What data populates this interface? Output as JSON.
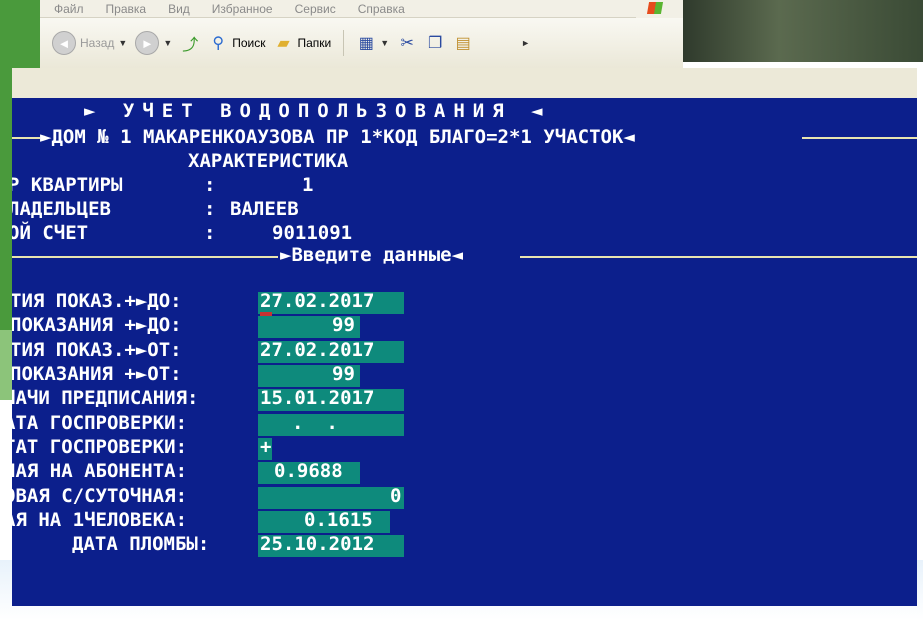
{
  "menu": [
    "Файл",
    "Правка",
    "Вид",
    "Избранное",
    "Сервис",
    "Справка"
  ],
  "toolbar": {
    "back_label": "Назад",
    "search_label": "Поиск",
    "folders_label": "Папки"
  },
  "dos": {
    "title": "► УЧЕТ ВОДОПОЛЬЗОВАНИЯ ◄",
    "header": "►ДОМ № 1 МАКАРЕНКОАУЗОВА ПР 1*КОД БЛАГО=2*1 УЧАСТОК◄",
    "section": "ХАРАКТЕРИСТИКА",
    "info": [
      {
        "label": "Р КВАРТИРЫ",
        "sep": ":",
        "value": "1"
      },
      {
        "label": "ЛАДЕЛЬЦЕВ",
        "sep": ":",
        "value": "ВАЛЕЕВ"
      },
      {
        "label": "ОЙ СЧЕТ",
        "sep": ":",
        "value": "9011091"
      }
    ],
    "prompt": "►Введите данные◄",
    "fields": [
      {
        "label": "ТИЯ ПОКАЗ.+►ДО:",
        "value": "27.02.2017"
      },
      {
        "label": "ПОКАЗАНИЯ +►ДО:",
        "value": "99"
      },
      {
        "label": "ТИЯ ПОКАЗ.+►ОТ:",
        "value": "27.02.2017"
      },
      {
        "label": "ПОКАЗАНИЯ +►ОТ:",
        "value": "99"
      },
      {
        "label": "ЧАЧИ ПРЕДПИСАНИЯ:",
        "value": "15.01.2017"
      },
      {
        "label": "АТА ГОСПРОВЕРКИ:",
        "value": ".  ."
      },
      {
        "label": "ТАТ ГОСПРОВЕРКИ:",
        "value": "+"
      },
      {
        "label": "НАЯ НА АБОНЕНТА:",
        "value": "0.9688"
      },
      {
        "label": "ОВАЯ С/СУТОЧНАЯ:",
        "value": "0"
      },
      {
        "label": "АЯ НА 1ЧЕЛОВЕКА:",
        "value": "0.1615"
      },
      {
        "label": "ДАТА ПЛОМБЫ:",
        "value": "25.10.2012"
      }
    ]
  }
}
